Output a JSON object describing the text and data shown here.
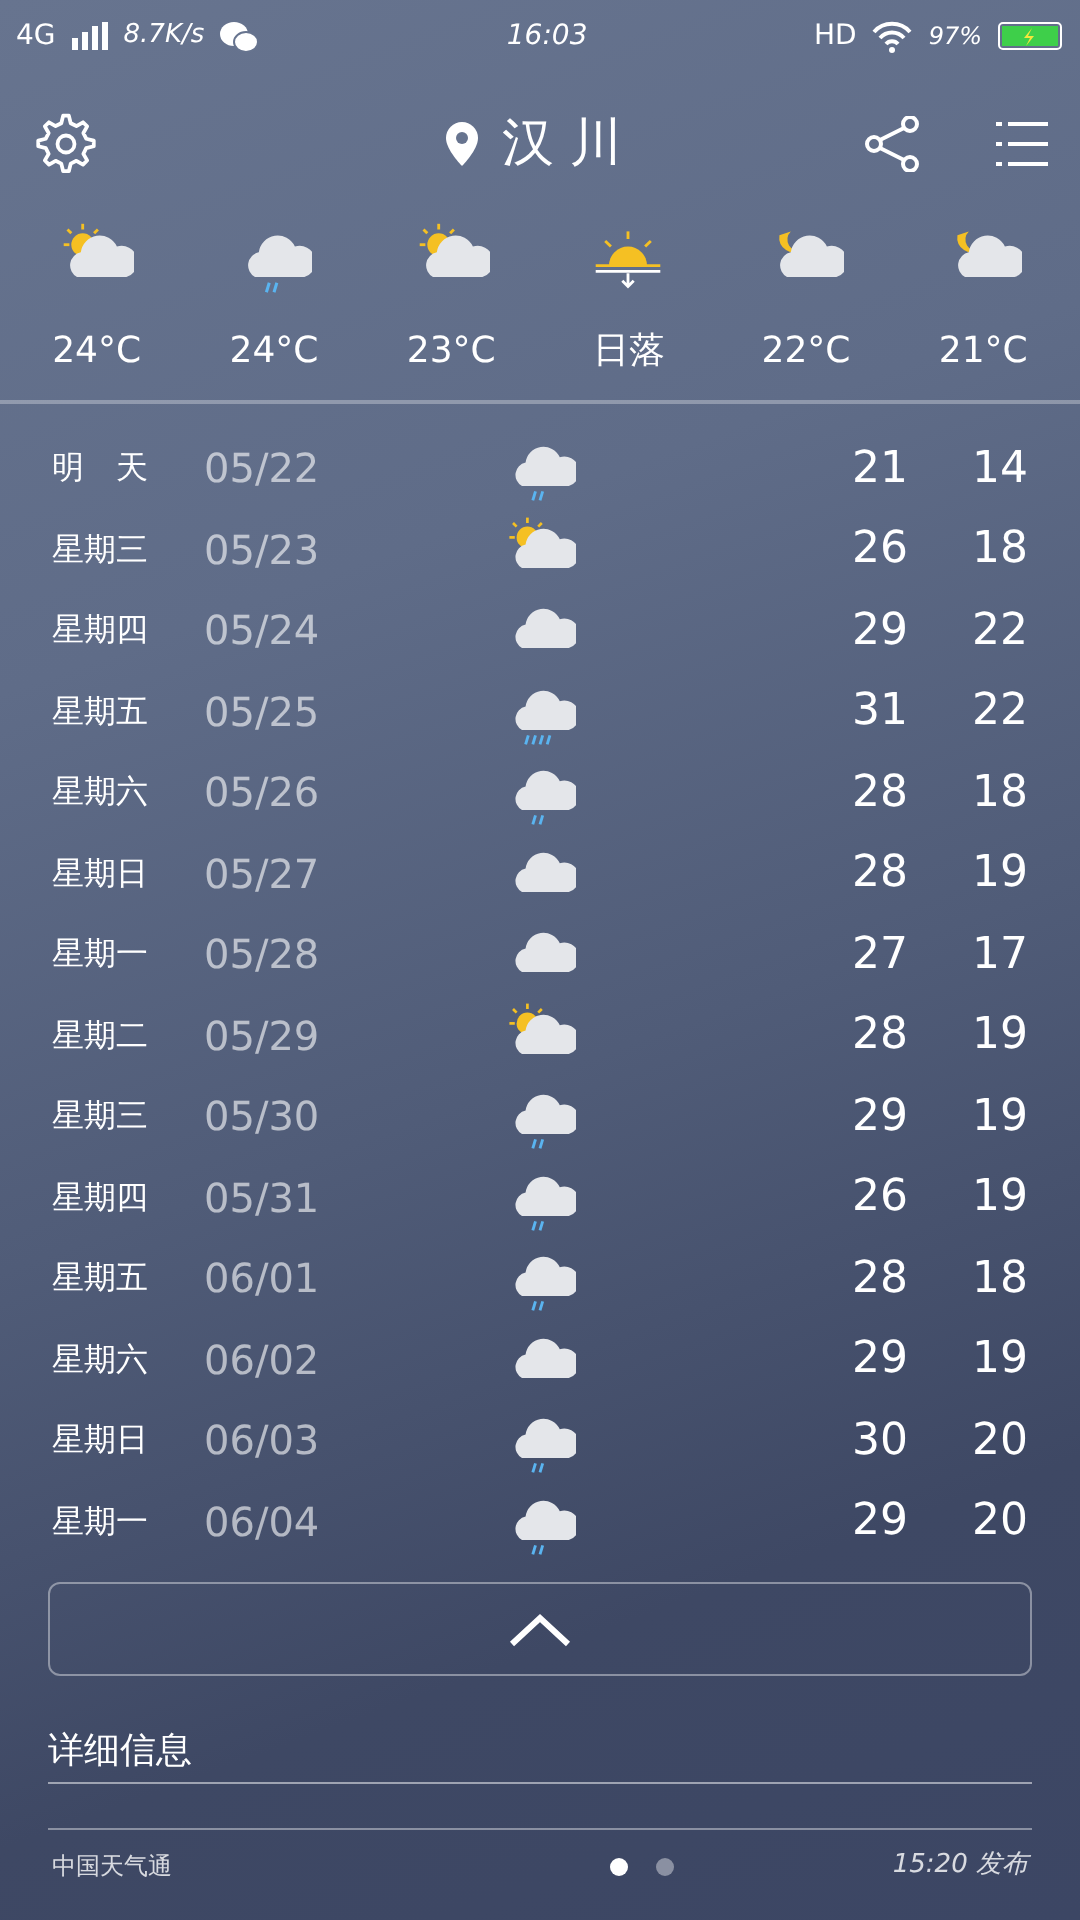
{
  "status_bar": {
    "network": "4G",
    "speed": "8.7K/s",
    "time": "16:03",
    "hd": "HD",
    "battery_text": "97%"
  },
  "header": {
    "city": "汉川"
  },
  "hourly": [
    {
      "kind": "partly_cloudy",
      "label": "24°C"
    },
    {
      "kind": "rain",
      "label": "24°C"
    },
    {
      "kind": "partly_cloudy",
      "label": "23°C"
    },
    {
      "kind": "sunset",
      "label": "日落"
    },
    {
      "kind": "moon_cloudy",
      "label": "22°C"
    },
    {
      "kind": "moon_cloudy",
      "label": "21°C"
    }
  ],
  "daily": [
    {
      "day": "明　天",
      "date": "05/22",
      "kind": "rain",
      "high": "21",
      "low": "14"
    },
    {
      "day": "星期三",
      "date": "05/23",
      "kind": "partly_cloudy",
      "high": "26",
      "low": "18"
    },
    {
      "day": "星期四",
      "date": "05/24",
      "kind": "cloudy",
      "high": "29",
      "low": "22"
    },
    {
      "day": "星期五",
      "date": "05/25",
      "kind": "heavy_rain",
      "high": "31",
      "low": "22"
    },
    {
      "day": "星期六",
      "date": "05/26",
      "kind": "rain",
      "high": "28",
      "low": "18"
    },
    {
      "day": "星期日",
      "date": "05/27",
      "kind": "cloudy",
      "high": "28",
      "low": "19"
    },
    {
      "day": "星期一",
      "date": "05/28",
      "kind": "cloudy",
      "high": "27",
      "low": "17"
    },
    {
      "day": "星期二",
      "date": "05/29",
      "kind": "partly_cloudy",
      "high": "28",
      "low": "19"
    },
    {
      "day": "星期三",
      "date": "05/30",
      "kind": "rain",
      "high": "29",
      "low": "19"
    },
    {
      "day": "星期四",
      "date": "05/31",
      "kind": "rain",
      "high": "26",
      "low": "19"
    },
    {
      "day": "星期五",
      "date": "06/01",
      "kind": "rain",
      "high": "28",
      "low": "18"
    },
    {
      "day": "星期六",
      "date": "06/02",
      "kind": "cloudy",
      "high": "29",
      "low": "19"
    },
    {
      "day": "星期日",
      "date": "06/03",
      "kind": "rain",
      "high": "30",
      "low": "20"
    },
    {
      "day": "星期一",
      "date": "06/04",
      "kind": "rain",
      "high": "29",
      "low": "20"
    }
  ],
  "details": {
    "title": "详细信息"
  },
  "footer": {
    "source": "中国天气通",
    "pages": [
      {
        "selected": true
      },
      {
        "selected": false
      }
    ],
    "published": "15:20 发布"
  }
}
